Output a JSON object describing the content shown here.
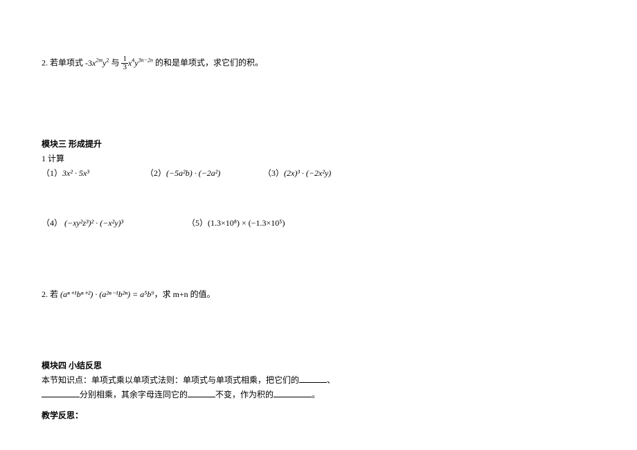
{
  "problem2": {
    "prefix": "2. 若单项式 ",
    "expr1_a": "-3",
    "expr1_b": "x",
    "expr1_exp1": "2m",
    "expr1_c": "y",
    "expr1_exp2": "2",
    "mid1": " 与 ",
    "frac_num": "1",
    "frac_den": "3",
    "expr2_a": "x",
    "expr2_exp1": "4",
    "expr2_b": "y",
    "expr2_exp2": "3n−2n",
    "suffix": " 的和是单项式，求它们的积。"
  },
  "module3": {
    "title": "模块三 形成提升",
    "q1_label": "1 计算",
    "row1": {
      "item1_num": "（1）",
      "item1_math": "3x² · 5x³",
      "item2_num": "（2）",
      "item2_math": "(−5a²b) · (−2a²)",
      "item3_num": "（3）",
      "item3_math": "(2x)³ · (−2x²y)"
    },
    "row2": {
      "item4_num": "（4）",
      "item4_math": "(−xy²z³)² · (−x²y)³",
      "item5_num": "（5）",
      "item5_math": "(1.3×10⁸) × (−1.3×10⁵)"
    },
    "q2_prefix": "2. 若 ",
    "q2_expr": "(aⁿ⁺¹bⁿ⁺²) · (a²ⁿ⁻¹b²ⁿ) = a⁵b⁹",
    "q2_suffix": "，求 m+n 的值。"
  },
  "module4": {
    "title": "模块四 小结反思",
    "line1_a": "本节知识点：单项式乘以单项式法则：单项式与单项式相乘，把它们的",
    "line1_b": "、",
    "line2_a": "分别相乘，其余字母连同它的",
    "line2_b": "不变，作为积的",
    "line2_c": "。",
    "reflect": "教学反思："
  }
}
